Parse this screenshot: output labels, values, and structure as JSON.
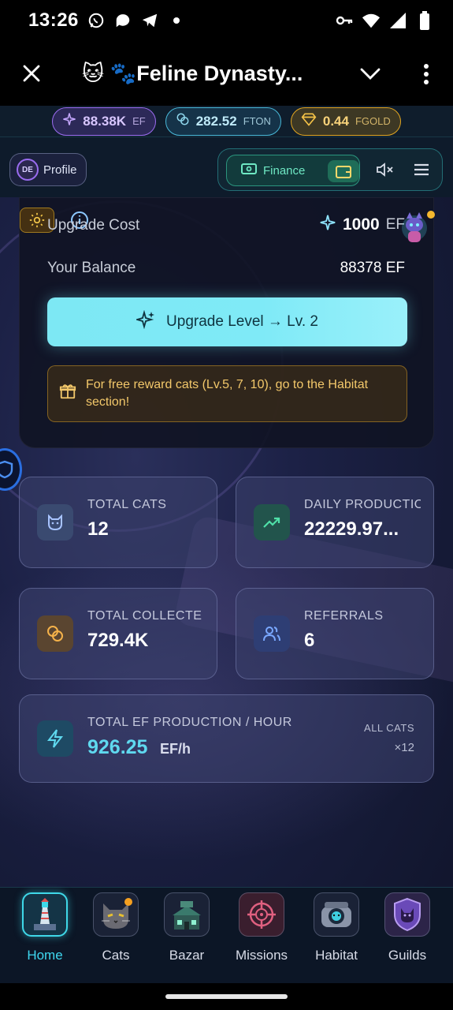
{
  "statusbar": {
    "time": "13:26"
  },
  "appbar": {
    "title": "🐱 🐾Feline Dynasty..."
  },
  "currencies": [
    {
      "value": "88.38K",
      "unit": "EF",
      "color": "#9b6cf0"
    },
    {
      "value": "282.52",
      "unit": "FTON",
      "color": "#48b8d8"
    },
    {
      "value": "0.44",
      "unit": "FGOLD",
      "color": "#e0a420"
    }
  ],
  "nav": {
    "avatar_initials": "DE",
    "profile_label": "Profile",
    "finance_label": "Finance"
  },
  "upgrade": {
    "cost_label": "Upgrade Cost",
    "cost_value": "1000",
    "cost_unit": "EF",
    "balance_label": "Your Balance",
    "balance_value": "88378 EF",
    "button_label": "Upgrade Level → Lv. 2",
    "note": "For free reward cats (Lv.5, 7, 10), go to the Habitat section!"
  },
  "stats": [
    {
      "label": "TOTAL CATS",
      "value": "12",
      "icon": "cat-icon"
    },
    {
      "label": "DAILY PRODUCTIO",
      "value": "22229.97...",
      "icon": "trend-up-icon"
    },
    {
      "label": "TOTAL COLLECTE",
      "value": "729.4K",
      "icon": "coins-icon"
    },
    {
      "label": "REFERRALS",
      "value": "6",
      "icon": "users-icon"
    }
  ],
  "production": {
    "label": "TOTAL EF PRODUCTION / HOUR",
    "value": "926.25",
    "unit": "EF/h",
    "all_cats_label": "ALL CATS",
    "multiplier": "×12"
  },
  "bottom_nav": [
    {
      "label": "Home",
      "active": true
    },
    {
      "label": "Cats",
      "active": false
    },
    {
      "label": "Bazar",
      "active": false
    },
    {
      "label": "Missions",
      "active": false
    },
    {
      "label": "Habitat",
      "active": false
    },
    {
      "label": "Guilds",
      "active": false
    }
  ],
  "colors": {
    "accent": "#3fd8e8",
    "upgrade_button": "#7de8f4",
    "gold": "#f3c86a"
  }
}
